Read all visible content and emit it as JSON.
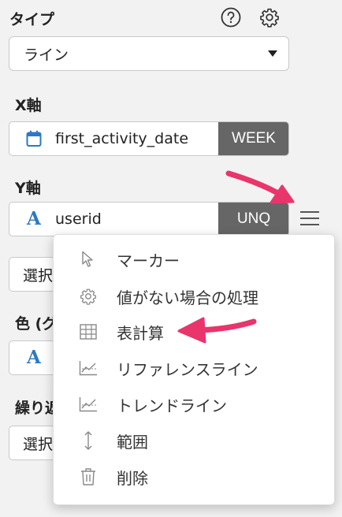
{
  "type_section": {
    "label": "タイプ",
    "help_icon": "help-circle-icon",
    "settings_icon": "gear-icon",
    "select_value": "ライン"
  },
  "x_axis": {
    "label": "X軸",
    "field_icon": "calendar-icon",
    "field": "first_activity_date",
    "tag": "WEEK"
  },
  "y_axis": {
    "label": "Y軸",
    "field_icon": "text-type-icon",
    "field_type_letter": "A",
    "field": "userid",
    "tag": "UNQ",
    "menu_icon": "hamburger-menu-icon"
  },
  "partial": {
    "select1": "選択",
    "color_label": "色 (グ",
    "color_letter": "A",
    "repeat_label": "繰り返",
    "select2": "選択"
  },
  "context_menu": {
    "items": [
      {
        "label": "マーカー",
        "icon": "cursor-pointer-icon"
      },
      {
        "label": "値がない場合の処理",
        "icon": "gear-icon"
      },
      {
        "label": "表計算",
        "icon": "table-icon"
      },
      {
        "label": "リファレンスライン",
        "icon": "chart-line-icon"
      },
      {
        "label": "トレンドライン",
        "icon": "chart-line-icon"
      },
      {
        "label": "範囲",
        "icon": "vertical-arrows-icon"
      },
      {
        "label": "削除",
        "icon": "trash-icon"
      }
    ]
  },
  "colors": {
    "accent_blue": "#2b79c2",
    "tag_gray": "#666666",
    "annotation_pink": "#e8356b"
  }
}
